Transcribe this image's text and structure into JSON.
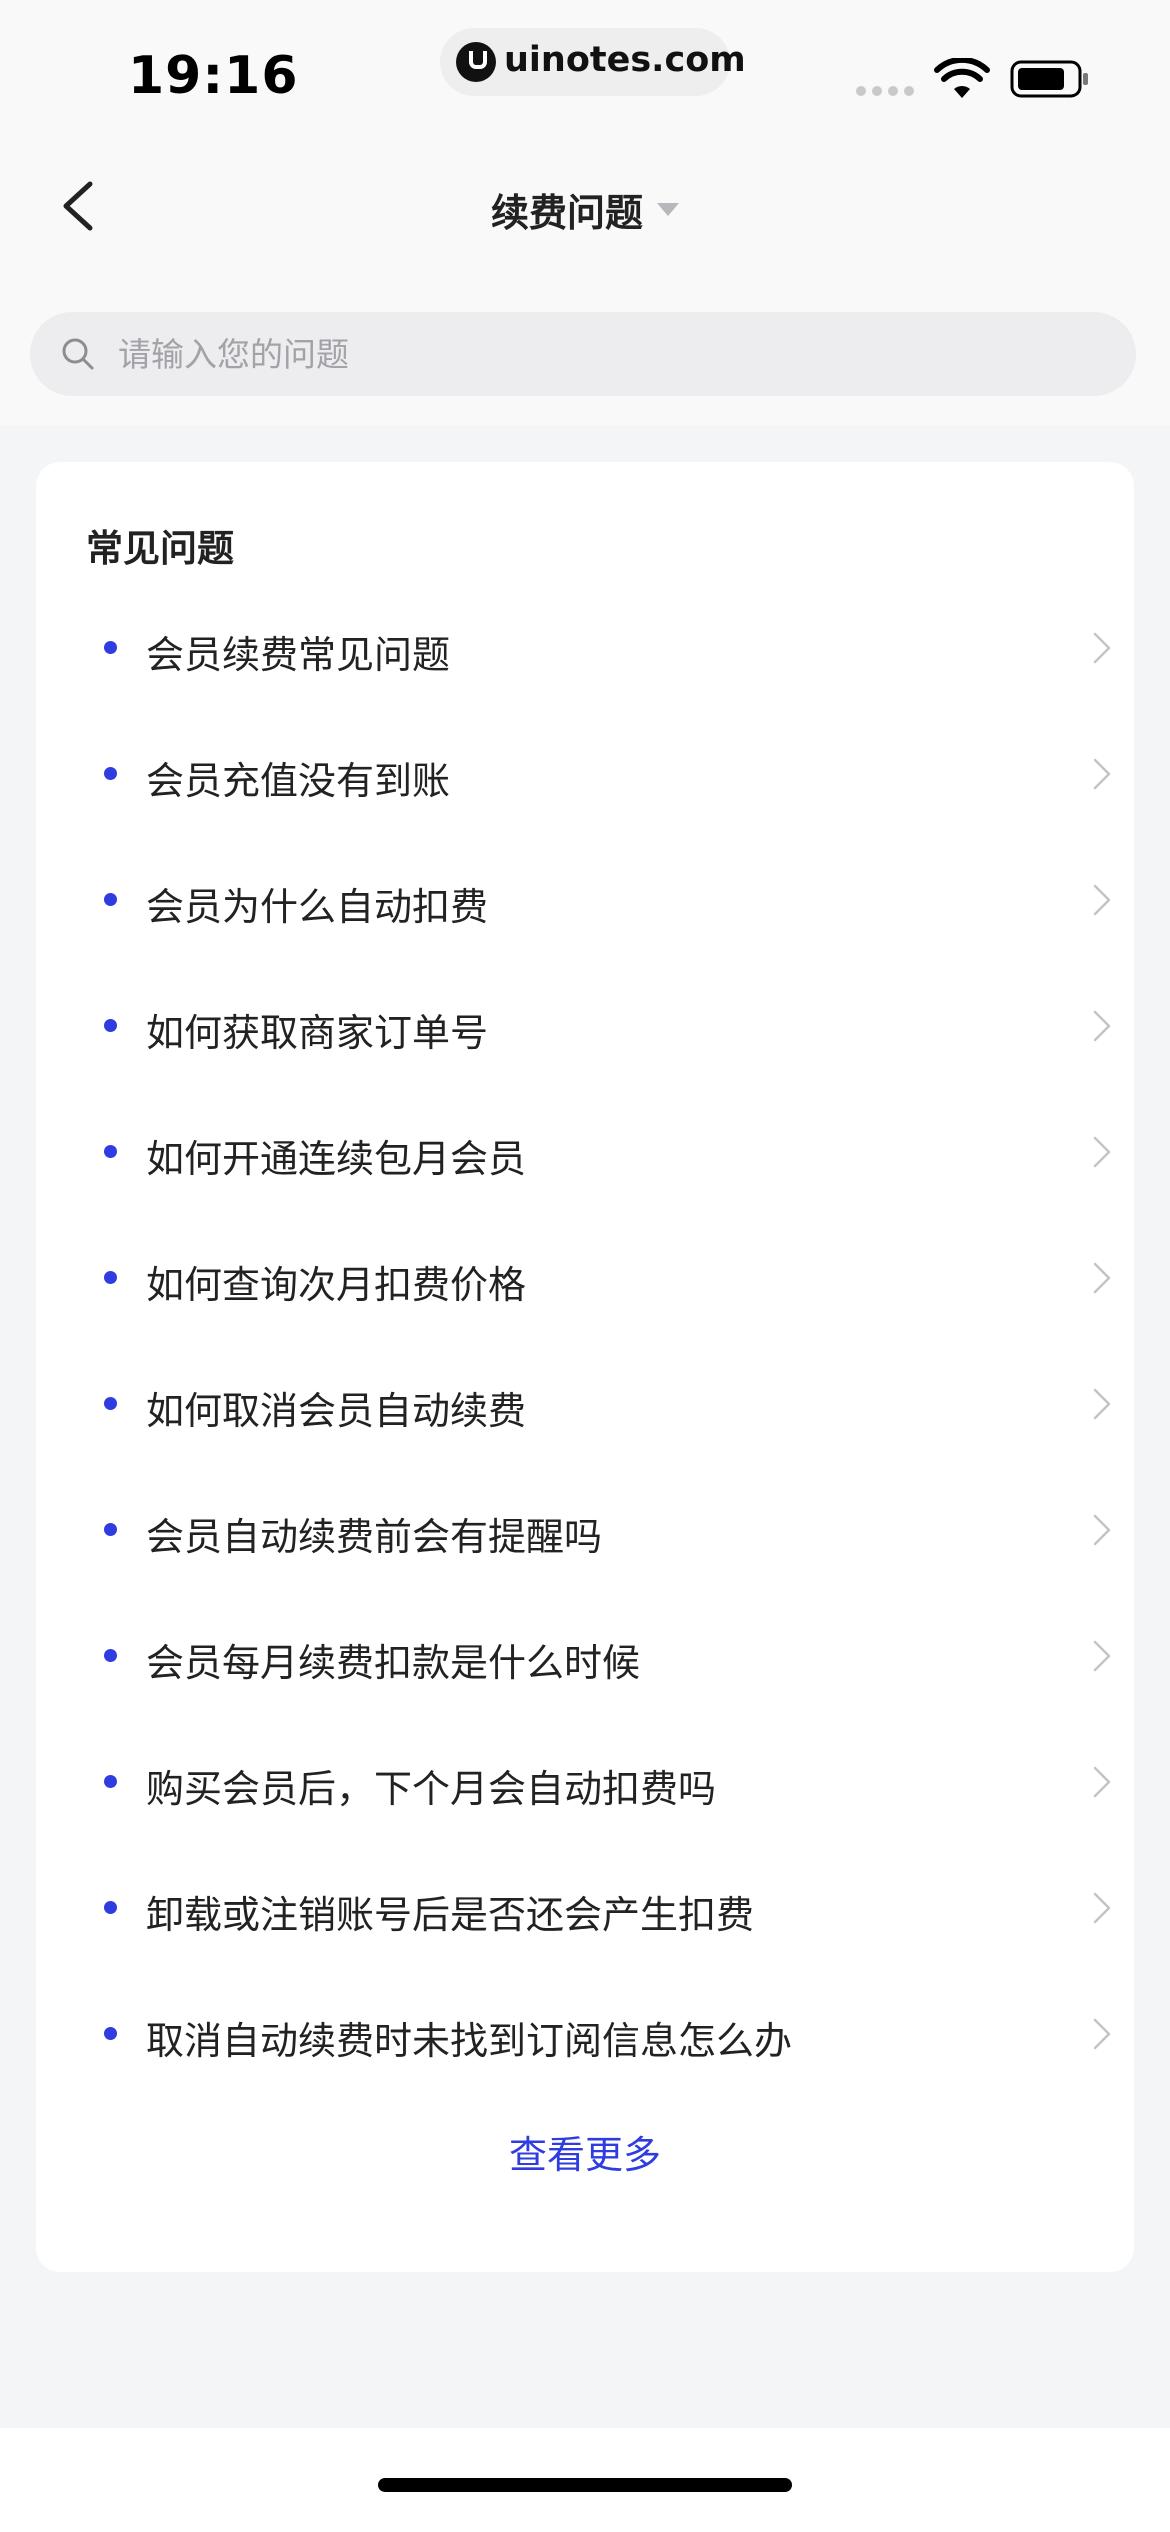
{
  "status_bar": {
    "time": "19:16",
    "url": "uinotes.com",
    "wifi_icon": "wifi-icon",
    "battery_icon": "battery-icon"
  },
  "nav": {
    "back_icon": "chevron-left-icon",
    "title": "续费问题",
    "dropdown_icon": "caret-down-icon"
  },
  "search": {
    "icon": "search-icon",
    "placeholder": "请输入您的问题",
    "value": ""
  },
  "faq": {
    "title": "常见问题",
    "items": [
      {
        "label": "会员续费常见问题"
      },
      {
        "label": "会员充值没有到账"
      },
      {
        "label": "会员为什么自动扣费"
      },
      {
        "label": "如何获取商家订单号"
      },
      {
        "label": "如何开通连续包月会员"
      },
      {
        "label": "如何查询次月扣费价格"
      },
      {
        "label": "如何取消会员自动续费"
      },
      {
        "label": "会员自动续费前会有提醒吗"
      },
      {
        "label": "会员每月续费扣款是什么时候"
      },
      {
        "label": "购买会员后，下个月会自动扣费吗"
      },
      {
        "label": "卸载或注销账号后是否还会产生扣费"
      },
      {
        "label": "取消自动续费时未找到订阅信息怎么办"
      }
    ],
    "see_more": "查看更多"
  },
  "colors": {
    "accent": "#2f3ce0",
    "background": "#f4f5f7",
    "card": "#ffffff"
  }
}
